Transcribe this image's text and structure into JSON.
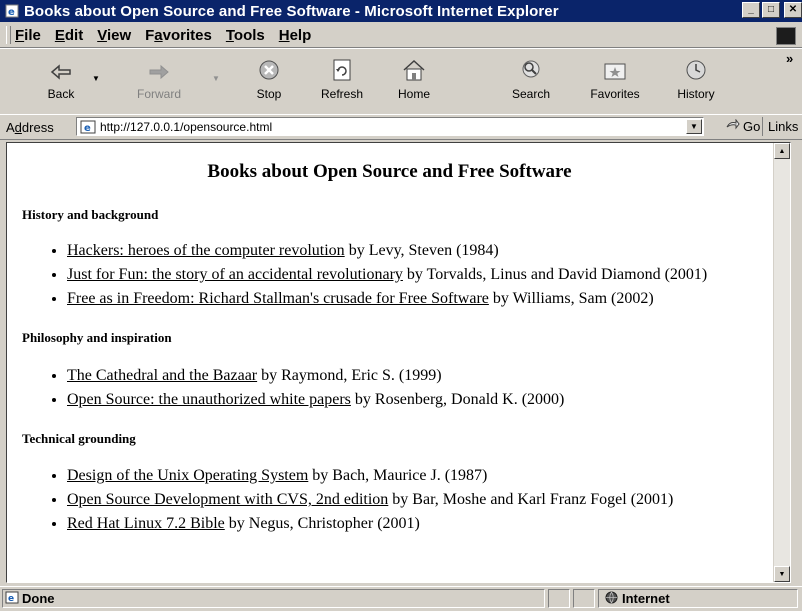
{
  "window": {
    "title": "Books about Open Source and Free Software - Microsoft Internet Explorer",
    "buttons": {
      "minimize": "_",
      "maximize": "□",
      "close": "✕"
    }
  },
  "menu": {
    "items": [
      {
        "first": "F",
        "rest": "ile"
      },
      {
        "first": "E",
        "rest": "dit"
      },
      {
        "first": "V",
        "rest": "iew"
      },
      {
        "first": "Fa",
        "pre": "F",
        "ul": "a",
        "rest": "vorites"
      },
      {
        "first": "T",
        "rest": "ools"
      },
      {
        "first": "H",
        "rest": "elp"
      }
    ]
  },
  "toolbar": {
    "back": "Back",
    "forward": "Forward",
    "stop": "Stop",
    "refresh": "Refresh",
    "home": "Home",
    "search": "Search",
    "favorites": "Favorites",
    "history": "History",
    "overflow": "»"
  },
  "address": {
    "label_pre": "A",
    "label_ul": "d",
    "label_rest": "dress",
    "url": "http://127.0.0.1/opensource.html",
    "go": "Go",
    "links": "Links"
  },
  "page": {
    "title": "Books about Open Source and Free Software",
    "sections": [
      {
        "heading": "History and background",
        "books": [
          {
            "title": "Hackers: heroes of the computer revolution",
            "by": " by Levy, Steven (1984)"
          },
          {
            "title": "Just for Fun: the story of an accidental revolutionary",
            "by": " by Torvalds, Linus and David Diamond (2001)"
          },
          {
            "title": "Free as in Freedom: Richard Stallman's crusade for Free Software",
            "by": " by Williams, Sam (2002)"
          }
        ]
      },
      {
        "heading": "Philosophy and inspiration",
        "books": [
          {
            "title": "The Cathedral and the Bazaar",
            "by": " by Raymond, Eric S. (1999)"
          },
          {
            "title": "Open Source: the unauthorized white papers",
            "by": " by Rosenberg, Donald K. (2000)"
          }
        ]
      },
      {
        "heading": "Technical grounding",
        "books": [
          {
            "title": "Design of the Unix Operating System",
            "by": " by Bach, Maurice J. (1987)"
          },
          {
            "title": "Open Source Development with CVS, 2nd edition",
            "by": " by Bar, Moshe and Karl Franz Fogel (2001)"
          },
          {
            "title": "Red Hat Linux 7.2 Bible",
            "by": " by Negus, Christopher (2001)"
          }
        ]
      }
    ]
  },
  "status": {
    "text": "Done",
    "zone": "Internet"
  },
  "colors": {
    "titlebar": "#0a246a",
    "chrome": "#d4d0c8"
  }
}
